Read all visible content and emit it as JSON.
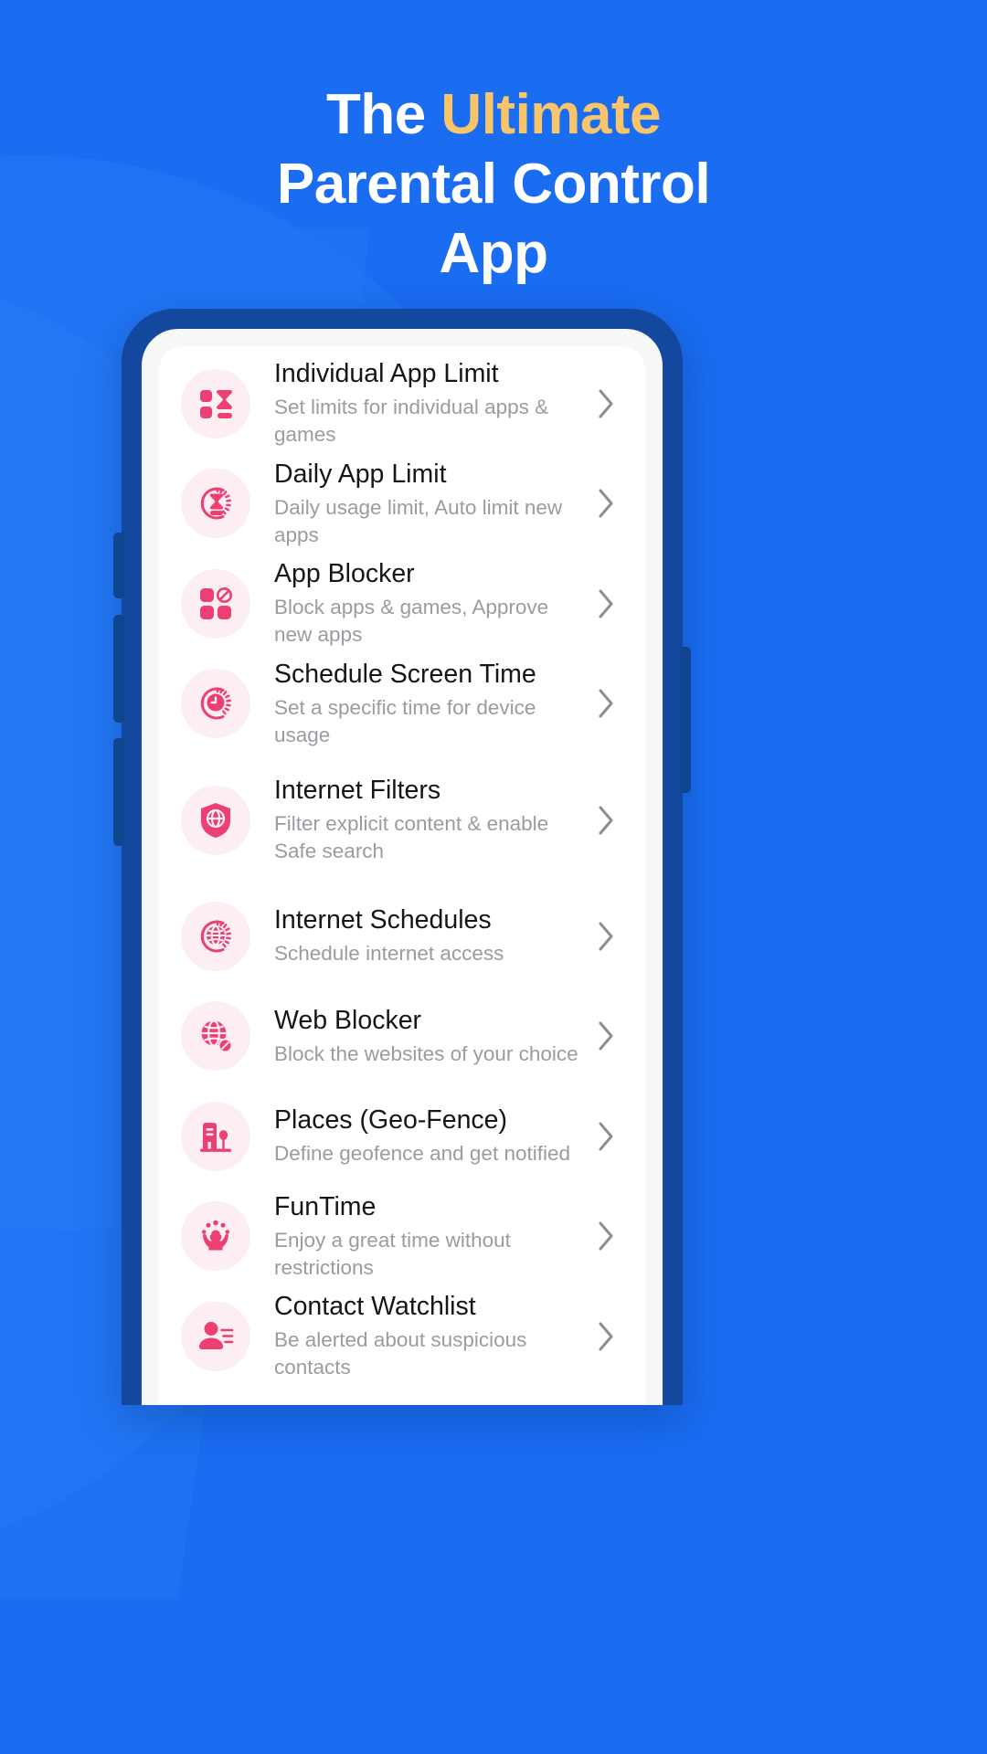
{
  "headline": {
    "line1_a": "The ",
    "line1_b": "Ultimate",
    "line2": "Parental Control",
    "line3": "App"
  },
  "colors": {
    "background_blue": "#1a6cf1",
    "accent_gold": "#f9c46a",
    "phone_frame": "#12499e",
    "icon_pink": "#ec3f72",
    "icon_bg_pink": "#fdeef3",
    "title_text": "#15161a",
    "subtitle_text": "#9b9ba2",
    "chevron_gray": "#8d8d93"
  },
  "phone": {
    "buttons": [
      "volume-up",
      "volume-down",
      "volume-extra",
      "power"
    ]
  },
  "features": [
    {
      "title": "Individual App Limit",
      "subtitle": "Set limits for individual apps & games",
      "icon": "squares-hourglass-icon",
      "chevron": "chevron-right-icon"
    },
    {
      "title": "Daily App Limit",
      "subtitle": "Daily usage limit, Auto limit new apps",
      "icon": "hourglass-dial-icon",
      "chevron": "chevron-right-icon"
    },
    {
      "title": "App Blocker",
      "subtitle": "Block apps & games, Approve new apps",
      "icon": "app-grid-blocked-icon",
      "chevron": "chevron-right-icon"
    },
    {
      "title": "Schedule Screen Time",
      "subtitle": "Set a specific time for device usage",
      "icon": "clock-dial-icon",
      "chevron": "chevron-right-icon"
    },
    {
      "title": "Internet Filters",
      "subtitle": "Filter explicit content & enable Safe search",
      "icon": "shield-globe-icon",
      "chevron": "chevron-right-icon"
    },
    {
      "title": "Internet Schedules",
      "subtitle": "Schedule internet access",
      "icon": "globe-dial-icon",
      "chevron": "chevron-right-icon"
    },
    {
      "title": "Web Blocker",
      "subtitle": "Block the websites of your choice",
      "icon": "globe-blocked-icon",
      "chevron": "chevron-right-icon"
    },
    {
      "title": "Places (Geo-Fence)",
      "subtitle": "Define geofence and get notified",
      "icon": "building-tree-icon",
      "chevron": "chevron-right-icon"
    },
    {
      "title": "FunTime",
      "subtitle": "Enjoy a great time without restrictions",
      "icon": "hands-celebration-icon",
      "chevron": "chevron-right-icon"
    },
    {
      "title": "Contact Watchlist",
      "subtitle": "Be alerted about suspicious contacts",
      "icon": "contact-person-icon",
      "chevron": "chevron-right-icon"
    }
  ]
}
